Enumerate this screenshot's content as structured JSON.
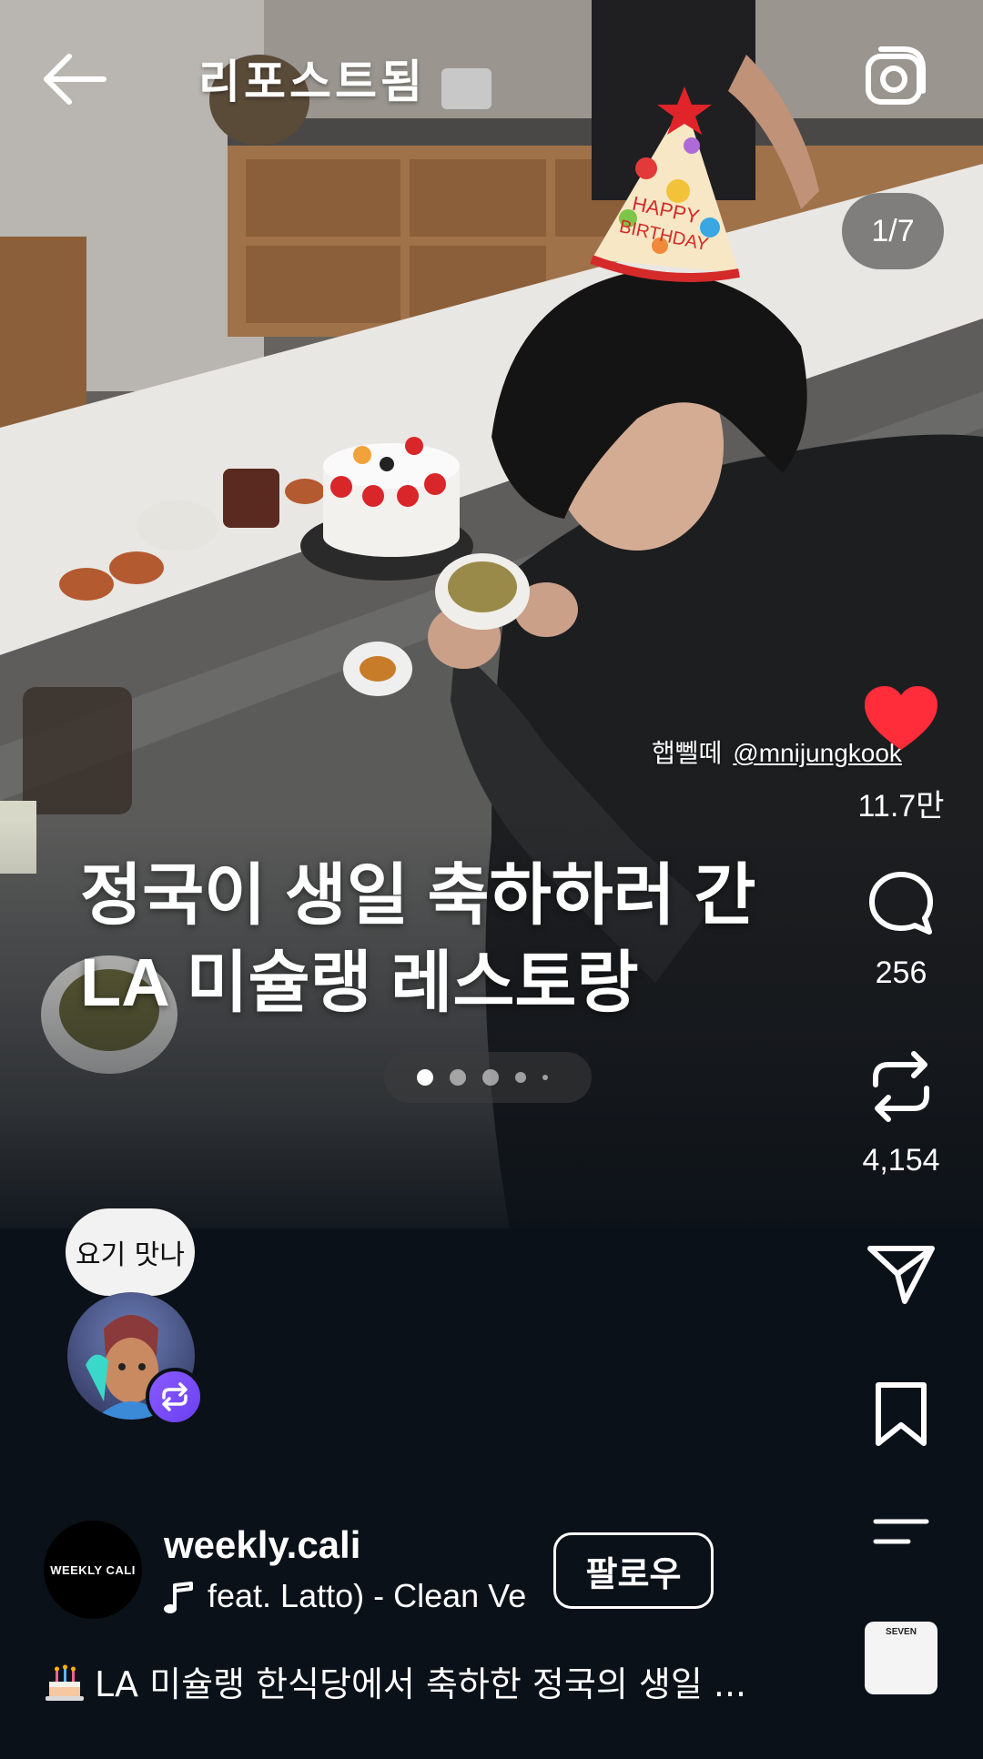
{
  "header": {
    "title": "리포스트됨",
    "page_counter": "1/7"
  },
  "post_media": {
    "tag_prefix": "햅뻴떼",
    "tag_handle": "@mnijungkook",
    "headline_line1": "정국이 생일 축하하러 간",
    "headline_line2": "LA 미슐랭 레스토랑",
    "carousel_dots": 5,
    "active_dot": 1,
    "hat_text_line1": "HAPPY",
    "hat_text_line2": "BIRTHDAY"
  },
  "actions": {
    "likes": "11.7만",
    "comments": "256",
    "reposts": "4,154",
    "like_color": "#ff2d3a"
  },
  "reposter": {
    "bubble_text": "요기 맛나"
  },
  "author": {
    "avatar_text": "WEEKLY CALI",
    "username": "weekly.cali",
    "music": "feat. Latto) - Clean Ve",
    "follow_label": "팔로우"
  },
  "caption": {
    "text": "LA 미슐랭 한식당에서 축하한 정국의 생일 ..."
  },
  "album_thumb": {
    "text": "SEVEN"
  }
}
